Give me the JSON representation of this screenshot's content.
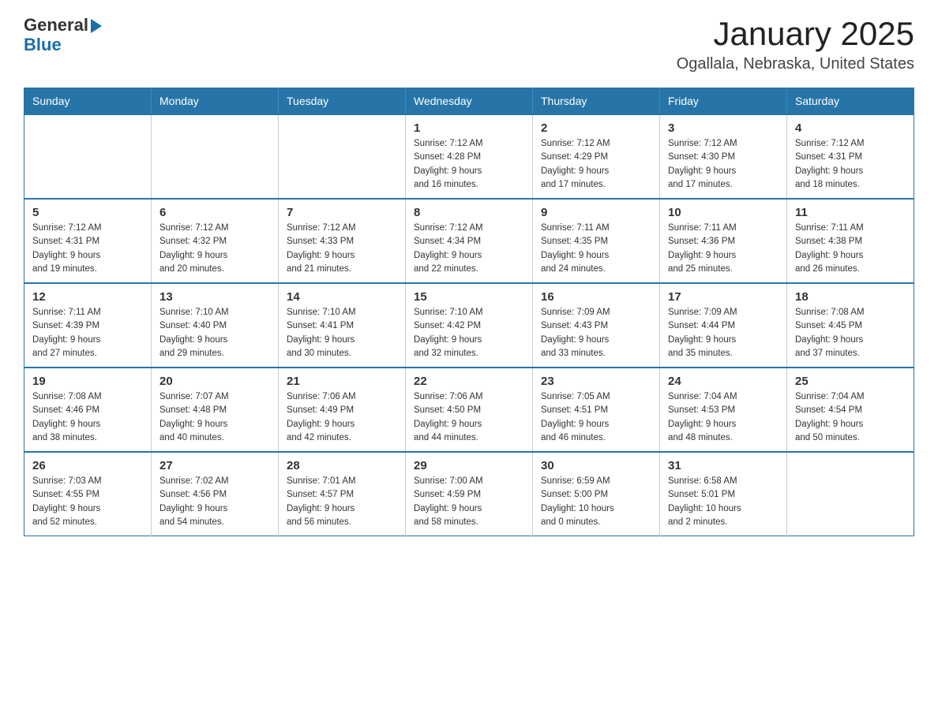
{
  "logo": {
    "general": "General",
    "blue": "Blue"
  },
  "header": {
    "month": "January 2025",
    "location": "Ogallala, Nebraska, United States"
  },
  "weekdays": [
    "Sunday",
    "Monday",
    "Tuesday",
    "Wednesday",
    "Thursday",
    "Friday",
    "Saturday"
  ],
  "weeks": [
    [
      {
        "day": "",
        "info": ""
      },
      {
        "day": "",
        "info": ""
      },
      {
        "day": "",
        "info": ""
      },
      {
        "day": "1",
        "info": "Sunrise: 7:12 AM\nSunset: 4:28 PM\nDaylight: 9 hours\nand 16 minutes."
      },
      {
        "day": "2",
        "info": "Sunrise: 7:12 AM\nSunset: 4:29 PM\nDaylight: 9 hours\nand 17 minutes."
      },
      {
        "day": "3",
        "info": "Sunrise: 7:12 AM\nSunset: 4:30 PM\nDaylight: 9 hours\nand 17 minutes."
      },
      {
        "day": "4",
        "info": "Sunrise: 7:12 AM\nSunset: 4:31 PM\nDaylight: 9 hours\nand 18 minutes."
      }
    ],
    [
      {
        "day": "5",
        "info": "Sunrise: 7:12 AM\nSunset: 4:31 PM\nDaylight: 9 hours\nand 19 minutes."
      },
      {
        "day": "6",
        "info": "Sunrise: 7:12 AM\nSunset: 4:32 PM\nDaylight: 9 hours\nand 20 minutes."
      },
      {
        "day": "7",
        "info": "Sunrise: 7:12 AM\nSunset: 4:33 PM\nDaylight: 9 hours\nand 21 minutes."
      },
      {
        "day": "8",
        "info": "Sunrise: 7:12 AM\nSunset: 4:34 PM\nDaylight: 9 hours\nand 22 minutes."
      },
      {
        "day": "9",
        "info": "Sunrise: 7:11 AM\nSunset: 4:35 PM\nDaylight: 9 hours\nand 24 minutes."
      },
      {
        "day": "10",
        "info": "Sunrise: 7:11 AM\nSunset: 4:36 PM\nDaylight: 9 hours\nand 25 minutes."
      },
      {
        "day": "11",
        "info": "Sunrise: 7:11 AM\nSunset: 4:38 PM\nDaylight: 9 hours\nand 26 minutes."
      }
    ],
    [
      {
        "day": "12",
        "info": "Sunrise: 7:11 AM\nSunset: 4:39 PM\nDaylight: 9 hours\nand 27 minutes."
      },
      {
        "day": "13",
        "info": "Sunrise: 7:10 AM\nSunset: 4:40 PM\nDaylight: 9 hours\nand 29 minutes."
      },
      {
        "day": "14",
        "info": "Sunrise: 7:10 AM\nSunset: 4:41 PM\nDaylight: 9 hours\nand 30 minutes."
      },
      {
        "day": "15",
        "info": "Sunrise: 7:10 AM\nSunset: 4:42 PM\nDaylight: 9 hours\nand 32 minutes."
      },
      {
        "day": "16",
        "info": "Sunrise: 7:09 AM\nSunset: 4:43 PM\nDaylight: 9 hours\nand 33 minutes."
      },
      {
        "day": "17",
        "info": "Sunrise: 7:09 AM\nSunset: 4:44 PM\nDaylight: 9 hours\nand 35 minutes."
      },
      {
        "day": "18",
        "info": "Sunrise: 7:08 AM\nSunset: 4:45 PM\nDaylight: 9 hours\nand 37 minutes."
      }
    ],
    [
      {
        "day": "19",
        "info": "Sunrise: 7:08 AM\nSunset: 4:46 PM\nDaylight: 9 hours\nand 38 minutes."
      },
      {
        "day": "20",
        "info": "Sunrise: 7:07 AM\nSunset: 4:48 PM\nDaylight: 9 hours\nand 40 minutes."
      },
      {
        "day": "21",
        "info": "Sunrise: 7:06 AM\nSunset: 4:49 PM\nDaylight: 9 hours\nand 42 minutes."
      },
      {
        "day": "22",
        "info": "Sunrise: 7:06 AM\nSunset: 4:50 PM\nDaylight: 9 hours\nand 44 minutes."
      },
      {
        "day": "23",
        "info": "Sunrise: 7:05 AM\nSunset: 4:51 PM\nDaylight: 9 hours\nand 46 minutes."
      },
      {
        "day": "24",
        "info": "Sunrise: 7:04 AM\nSunset: 4:53 PM\nDaylight: 9 hours\nand 48 minutes."
      },
      {
        "day": "25",
        "info": "Sunrise: 7:04 AM\nSunset: 4:54 PM\nDaylight: 9 hours\nand 50 minutes."
      }
    ],
    [
      {
        "day": "26",
        "info": "Sunrise: 7:03 AM\nSunset: 4:55 PM\nDaylight: 9 hours\nand 52 minutes."
      },
      {
        "day": "27",
        "info": "Sunrise: 7:02 AM\nSunset: 4:56 PM\nDaylight: 9 hours\nand 54 minutes."
      },
      {
        "day": "28",
        "info": "Sunrise: 7:01 AM\nSunset: 4:57 PM\nDaylight: 9 hours\nand 56 minutes."
      },
      {
        "day": "29",
        "info": "Sunrise: 7:00 AM\nSunset: 4:59 PM\nDaylight: 9 hours\nand 58 minutes."
      },
      {
        "day": "30",
        "info": "Sunrise: 6:59 AM\nSunset: 5:00 PM\nDaylight: 10 hours\nand 0 minutes."
      },
      {
        "day": "31",
        "info": "Sunrise: 6:58 AM\nSunset: 5:01 PM\nDaylight: 10 hours\nand 2 minutes."
      },
      {
        "day": "",
        "info": ""
      }
    ]
  ]
}
